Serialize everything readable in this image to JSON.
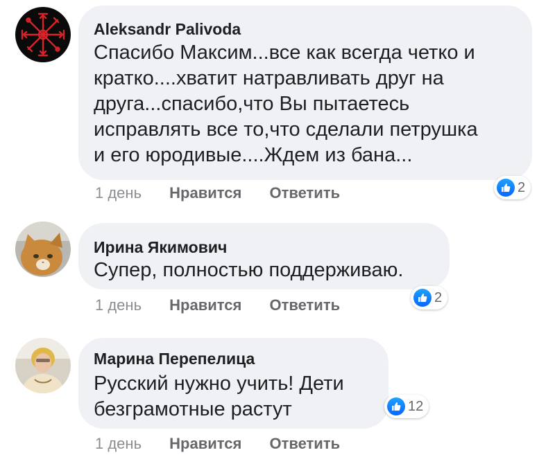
{
  "comments": [
    {
      "author": "Aleksandr Palivoda",
      "lines": [
        "Спасибо Максим...все как всегда четко и",
        "кратко....хватит натравливать друг на",
        "друга...спасибо,что Вы пытаетесь",
        "исправлять все то,что сделали петрушка",
        "и его юродивые....Ждем из бана..."
      ],
      "time": "1 день",
      "like_label": "Нравится",
      "reply_label": "Ответить",
      "reaction_count": "2",
      "avatar_icon": "vegvisir-symbol-icon"
    },
    {
      "author": "Ирина Якимович",
      "lines": [
        "Супер, полностью поддерживаю."
      ],
      "time": "1 день",
      "like_label": "Нравится",
      "reply_label": "Ответить",
      "reaction_count": "2",
      "avatar_icon": "cat-photo"
    },
    {
      "author": "Марина Перепелица",
      "lines": [
        "Русский нужно учить! Дети",
        "безграмотные растут"
      ],
      "time": "1 день",
      "like_label": "Нравится",
      "reply_label": "Ответить",
      "reaction_count": "12",
      "avatar_icon": "person-photo"
    }
  ],
  "colors": {
    "bubble": "#eff1f4",
    "text": "#1c1e21",
    "meta": "#65676b",
    "like_blue": "#0866ff"
  }
}
